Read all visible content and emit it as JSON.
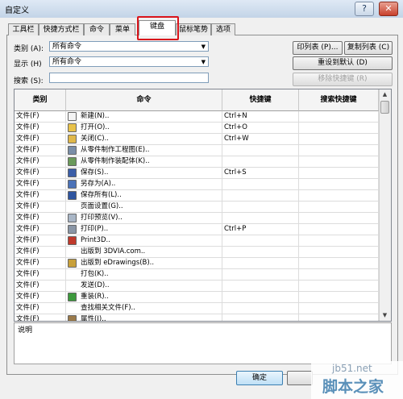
{
  "window": {
    "title": "自定义",
    "help_glyph": "?",
    "close_glyph": "✕"
  },
  "tabs": [
    {
      "label": "工具栏"
    },
    {
      "label": "快捷方式栏"
    },
    {
      "label": "命令"
    },
    {
      "label": "菜单"
    },
    {
      "label": "键盘",
      "selected": true
    },
    {
      "label": "鼠标笔势"
    },
    {
      "label": "选项"
    }
  ],
  "filters": {
    "category_label": "类别 (A):",
    "category_value": "所有命令",
    "show_label": "显示 (H)",
    "show_value": "所有命令",
    "search_label": "搜索 (S):",
    "search_value": ""
  },
  "buttons": {
    "print_list": "印列表 (P)...",
    "copy_list": "复制列表 (C)",
    "reset_default": "重设到默认 (D)",
    "remove_shortcut": "移除快捷键 (R)",
    "ok": "确定"
  },
  "grid": {
    "headers": [
      "类别",
      "命令",
      "快捷键",
      "搜索快捷键"
    ],
    "rows": [
      {
        "cat": "文件(F)",
        "cmd": "新建(N)..",
        "sc": "Ctrl+N",
        "icon": "new-doc-icon"
      },
      {
        "cat": "文件(F)",
        "cmd": "打开(O)..",
        "sc": "Ctrl+O",
        "icon": "open-folder-icon"
      },
      {
        "cat": "文件(F)",
        "cmd": "关闭(C)..",
        "sc": "Ctrl+W",
        "icon": "close-folder-icon"
      },
      {
        "cat": "文件(F)",
        "cmd": "从零件制作工程图(E)..",
        "sc": "",
        "icon": "drawing-icon"
      },
      {
        "cat": "文件(F)",
        "cmd": "从零件制作装配体(K)..",
        "sc": "",
        "icon": "assembly-icon"
      },
      {
        "cat": "文件(F)",
        "cmd": "保存(S)..",
        "sc": "Ctrl+S",
        "icon": "save-icon"
      },
      {
        "cat": "文件(F)",
        "cmd": "另存为(A)..",
        "sc": "",
        "icon": "save-as-icon"
      },
      {
        "cat": "文件(F)",
        "cmd": "保存所有(L)..",
        "sc": "",
        "icon": "save-all-icon"
      },
      {
        "cat": "文件(F)",
        "cmd": "页面设置(G)..",
        "sc": "",
        "icon": ""
      },
      {
        "cat": "文件(F)",
        "cmd": "打印预览(V)..",
        "sc": "",
        "icon": "print-preview-icon"
      },
      {
        "cat": "文件(F)",
        "cmd": "打印(P)..",
        "sc": "Ctrl+P",
        "icon": "print-icon"
      },
      {
        "cat": "文件(F)",
        "cmd": "Print3D..",
        "sc": "",
        "icon": "print3d-icon"
      },
      {
        "cat": "文件(F)",
        "cmd": "出版到 3DVIA.com..",
        "sc": "",
        "icon": ""
      },
      {
        "cat": "文件(F)",
        "cmd": "出版到 eDrawings(B)..",
        "sc": "",
        "icon": "edrawings-icon"
      },
      {
        "cat": "文件(F)",
        "cmd": "打包(K)..",
        "sc": "",
        "icon": ""
      },
      {
        "cat": "文件(F)",
        "cmd": "发送(D)..",
        "sc": "",
        "icon": ""
      },
      {
        "cat": "文件(F)",
        "cmd": "重装(R)..",
        "sc": "",
        "icon": "reload-icon"
      },
      {
        "cat": "文件(F)",
        "cmd": "查找相关文件(F)..",
        "sc": "",
        "icon": ""
      },
      {
        "cat": "文件(F)",
        "cmd": "属性(I)..",
        "sc": "",
        "icon": "properties-icon"
      }
    ]
  },
  "description": {
    "label": "说明"
  },
  "watermark": {
    "url": "jb51.net",
    "name": "脚本之家"
  },
  "colors": {
    "highlight": "#d9141b",
    "ok_border": "#3c7fb1"
  }
}
